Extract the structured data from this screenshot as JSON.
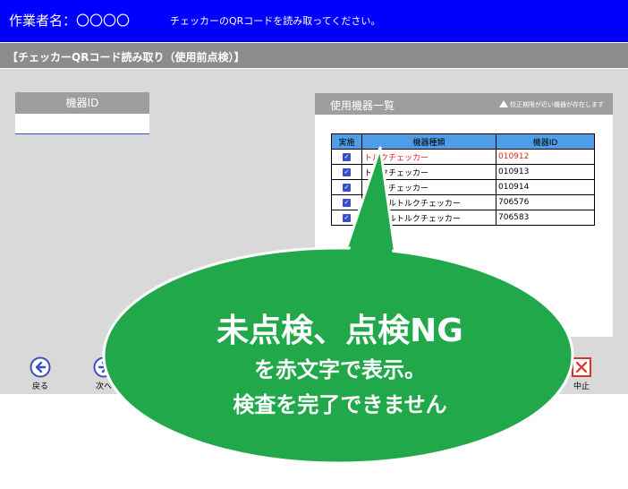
{
  "header": {
    "worker_label": "作業者名：〇〇〇〇",
    "instruction": "チェッカーのQRコードを読み取ってください。"
  },
  "screen_title": "【チェッカーQRコード読み取り（使用前点検）】",
  "device_id_panel": {
    "label": "機器ID",
    "value": ""
  },
  "device_list": {
    "title": "使用機器一覧",
    "warning": "校正期限が近い機器が存在します",
    "columns": [
      "実施",
      "機器種類",
      "機器ID"
    ],
    "rows": [
      {
        "checked": true,
        "type": "トルクチェッカー",
        "id": "010912",
        "status": "ng"
      },
      {
        "checked": true,
        "type": "トルクチェッカー",
        "id": "010913",
        "status": "ok"
      },
      {
        "checked": true,
        "type": "トルクチェッカー",
        "id": "010914",
        "status": "ok"
      },
      {
        "checked": true,
        "type": "デジタルトルクチェッカー",
        "id": "706576",
        "status": "ok"
      },
      {
        "checked": true,
        "type": "デジタルトルクチェッカー",
        "id": "706583",
        "status": "ok"
      }
    ]
  },
  "footer": {
    "back_label": "戻る",
    "next_label": "次へ",
    "stop_label": "中止"
  },
  "callout": {
    "line1": "未点検、点検NG",
    "line2": "を赤文字で表示。",
    "line3": "検査を完了できません"
  },
  "colors": {
    "header_bg": "#0000ff",
    "table_header": "#4e9de6",
    "ng_text": "#e0241b",
    "callout_green": "#20a84a"
  }
}
